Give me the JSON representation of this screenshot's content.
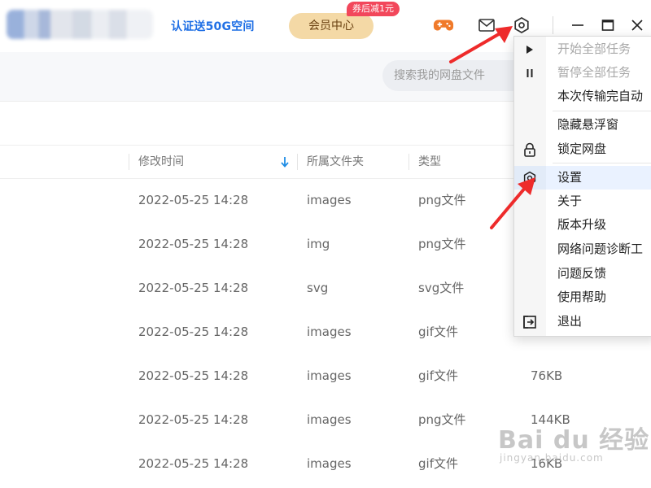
{
  "titlebar": {
    "verify_link": "认证送50G空间",
    "vip_button": "会员中心",
    "coupon_badge": "券后减1元"
  },
  "search": {
    "placeholder": "搜索我的网盘文件"
  },
  "table": {
    "columns": [
      "修改时间",
      "所属文件夹",
      "类型"
    ],
    "rows": [
      {
        "time": "2022-05-25 14:28",
        "folder": "images",
        "type": "png文件",
        "size": ""
      },
      {
        "time": "2022-05-25 14:28",
        "folder": "img",
        "type": "png文件",
        "size": ""
      },
      {
        "time": "2022-05-25 14:28",
        "folder": "svg",
        "type": "svg文件",
        "size": ""
      },
      {
        "time": "2022-05-25 14:28",
        "folder": "images",
        "type": "gif文件",
        "size": ""
      },
      {
        "time": "2022-05-25 14:28",
        "folder": "images",
        "type": "gif文件",
        "size": "76KB"
      },
      {
        "time": "2022-05-25 14:28",
        "folder": "images",
        "type": "png文件",
        "size": "144KB"
      },
      {
        "time": "2022-05-25 14:28",
        "folder": "images",
        "type": "gif文件",
        "size": "16KB"
      }
    ]
  },
  "menu": {
    "items": [
      {
        "label": "开始全部任务",
        "icon": "play-icon",
        "disabled": true
      },
      {
        "label": "暂停全部任务",
        "icon": "pause-icon",
        "disabled": true
      },
      {
        "label": "本次传输完自动",
        "icon": "",
        "disabled": false
      },
      {
        "label": "隐藏悬浮窗",
        "icon": "",
        "disabled": false
      },
      {
        "label": "锁定网盘",
        "icon": "lock-icon",
        "disabled": false
      },
      {
        "label": "设置",
        "icon": "gear-icon",
        "disabled": false,
        "highlighted": true
      },
      {
        "label": "关于",
        "icon": "",
        "disabled": false
      },
      {
        "label": "版本升级",
        "icon": "",
        "disabled": false
      },
      {
        "label": "网络问题诊断工",
        "icon": "",
        "disabled": false
      },
      {
        "label": "问题反馈",
        "icon": "",
        "disabled": false
      },
      {
        "label": "使用帮助",
        "icon": "",
        "disabled": false
      },
      {
        "label": "退出",
        "icon": "exit-icon",
        "disabled": false
      }
    ]
  },
  "watermark": {
    "brand": "Bai du 经验",
    "url": "jingyan.baidu.com"
  },
  "colors": {
    "accent": "#1f6fe5",
    "vip": "#f4d9a6",
    "badge": "#f2475b",
    "annotation": "#ee2b2b"
  }
}
